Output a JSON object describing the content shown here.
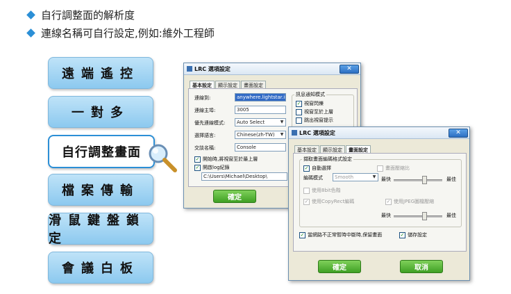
{
  "bullets": [
    "自行調整面的解析度",
    "連線名稱可自行設定,例如:維外工程師"
  ],
  "nav": [
    {
      "label": "遠端遙控"
    },
    {
      "label": "一對多"
    },
    {
      "label": "自行調整畫面"
    },
    {
      "label": "檔案傳輸"
    },
    {
      "label": "滑鼠鍵盤鎖定"
    },
    {
      "label": "會議白板"
    }
  ],
  "win1": {
    "title": "LRC 選項設定",
    "tabs": [
      "基本設定",
      "顯示設定",
      "畫面設定"
    ],
    "fields": {
      "connect_to_label": "連線到:",
      "connect_to_value": "anywhere.lightstar.info",
      "host_label": "連線主埠:",
      "host_value": "3005",
      "mode_label": "優先連線模式:",
      "mode_value": "Auto Select",
      "lang_label": "選擇語言:",
      "lang_value": "Chinese(zh-TW)",
      "name_label": "交談名稱:",
      "name_value": "Console"
    },
    "notify_group": "訊息通知模式",
    "notify_items": [
      "視窗閃爍",
      "視窗至於上層",
      "跳出視窗提示"
    ],
    "opt_top": "開始時,將視窗至於最上層",
    "opt_log": "開啟log紀錄",
    "log_path": "C:\\Users\\Michael\\Desktop\\",
    "ok": "確定"
  },
  "win2": {
    "title": "LRC 選項設定",
    "tabs": [
      "基本設定",
      "顯示設定",
      "畫面設定"
    ],
    "group": "擷取畫面編碼格式設定",
    "auto_select": "自動選擇",
    "scale": "畫面壓縮比",
    "encode_label": "編碼模式",
    "encode_value": "Smooth",
    "fast1": "最快",
    "best1": "最佳",
    "use8bit": "使用8bit色階",
    "copyrect": "使用CopyRect編碼",
    "jpeg": "使用JPEG圖檔壓縮",
    "fast2": "最快",
    "best2": "最佳",
    "keep": "當網路不正常暫時中斷時,保留畫面",
    "save": "儲存設定",
    "ok": "確定",
    "cancel": "取消"
  }
}
